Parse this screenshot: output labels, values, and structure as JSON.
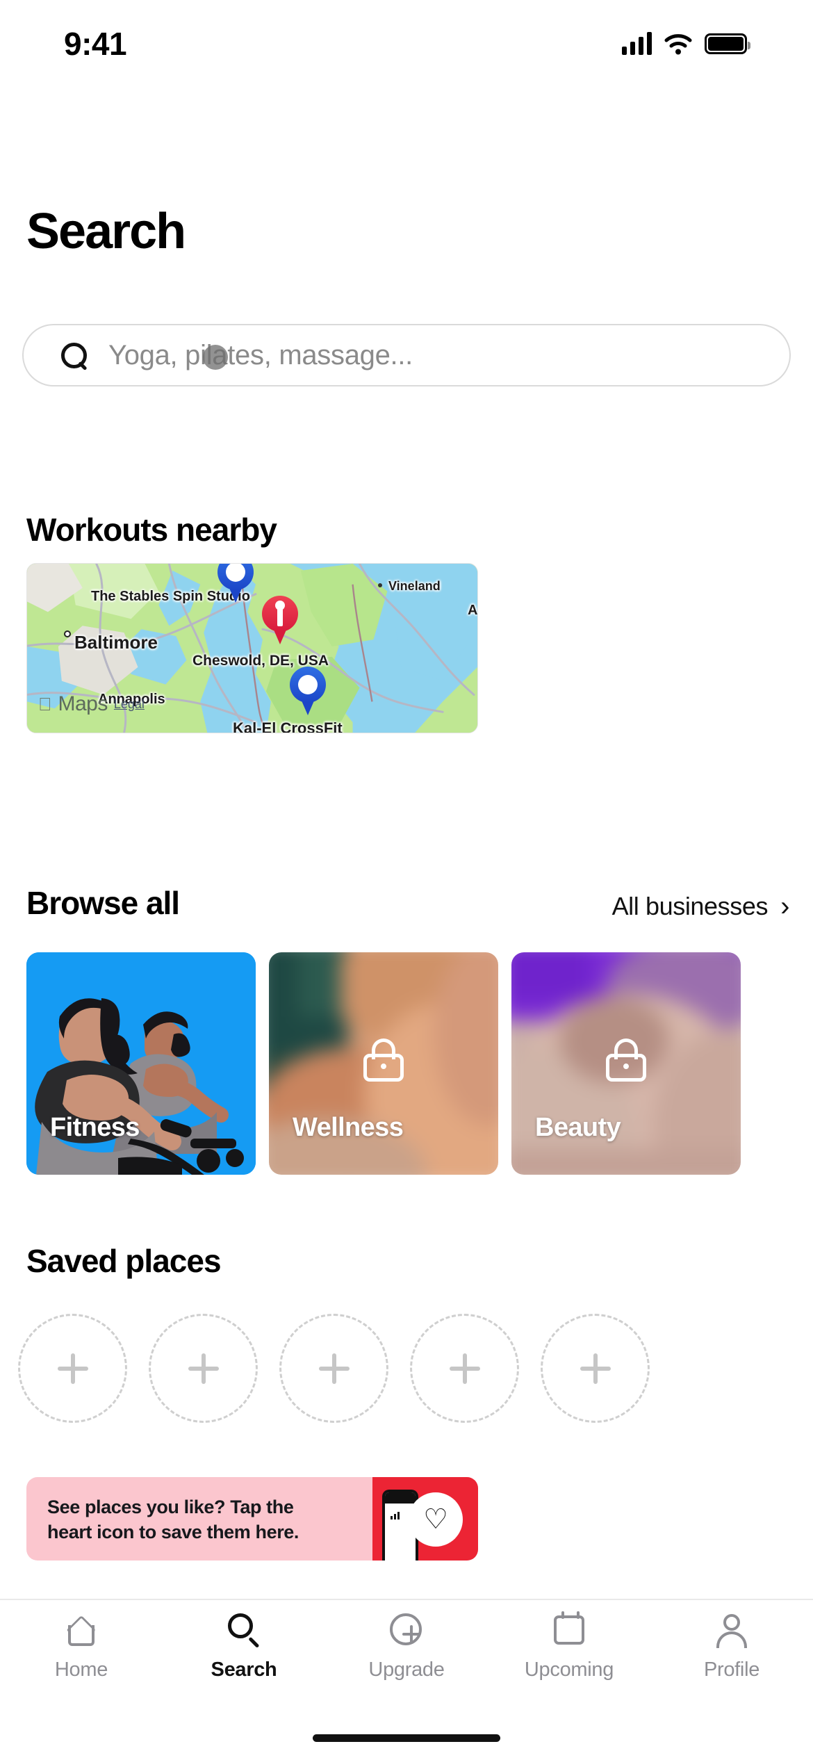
{
  "status_bar": {
    "time": "9:41",
    "cellular_icon": "cellular-bars-icon",
    "wifi_icon": "wifi-icon",
    "battery_icon": "battery-full-icon"
  },
  "header": {
    "title": "Search"
  },
  "search": {
    "placeholder": "Yoga, pilates, massage...",
    "value": "",
    "icon": "search-icon"
  },
  "workouts": {
    "heading": "Workouts nearby",
    "map": {
      "attribution": "Maps",
      "legal_label": "Legal",
      "apple_logo": "apple-logo-icon",
      "labels": [
        {
          "text": "The Stables Spin Studio"
        },
        {
          "text": "Vineland"
        },
        {
          "text": "Baltimore"
        },
        {
          "text": "Cheswold, DE, USA"
        },
        {
          "text": "Annapolis"
        },
        {
          "text": "Kal-El CrossFit"
        },
        {
          "text": "A"
        }
      ],
      "pins": [
        {
          "name": "pin-blue-top",
          "color": "#1c46c8"
        },
        {
          "name": "pin-red-center",
          "color": "#d81b3c"
        },
        {
          "name": "pin-blue-bottom",
          "color": "#1c46c8"
        }
      ]
    }
  },
  "browse": {
    "heading": "Browse all",
    "all_link": "All businesses",
    "chevron": "›",
    "cards": [
      {
        "label": "Fitness",
        "locked": false
      },
      {
        "label": "Wellness",
        "locked": true
      },
      {
        "label": "Beauty",
        "locked": true
      }
    ]
  },
  "saved_places": {
    "heading": "Saved places",
    "placeholders": 5,
    "add_icon": "plus-icon"
  },
  "banner": {
    "text": "See places you like? Tap the heart icon to save them here.",
    "heart_icon": "heart-icon"
  },
  "tabbar": {
    "items": [
      {
        "label": "Home",
        "icon": "home-icon",
        "active": false
      },
      {
        "label": "Search",
        "icon": "search-icon",
        "active": true
      },
      {
        "label": "Upgrade",
        "icon": "plus-circle-icon",
        "active": false
      },
      {
        "label": "Upcoming",
        "icon": "calendar-icon",
        "active": false
      },
      {
        "label": "Profile",
        "icon": "person-icon",
        "active": false
      }
    ]
  },
  "colors": {
    "accent_blue": "#159bf3",
    "pin_red": "#d81b3c",
    "pin_blue": "#1c46c8",
    "banner_pink": "#fbc6ce",
    "banner_red": "#ec2434",
    "muted": "#8e8e93"
  }
}
